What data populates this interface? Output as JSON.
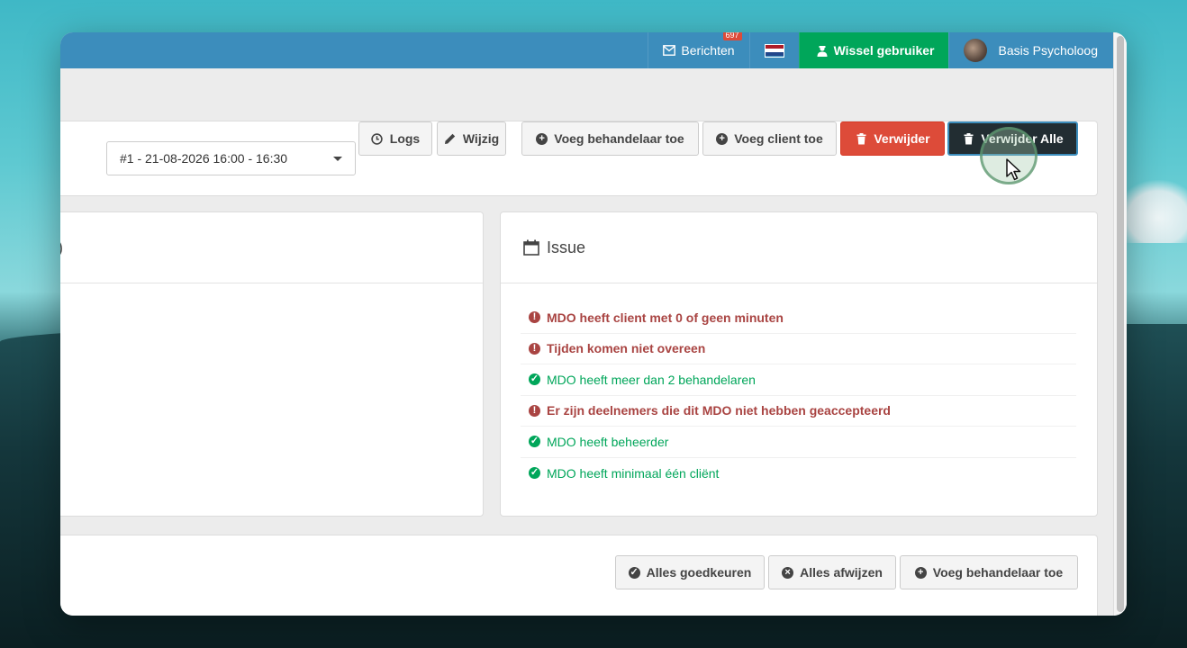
{
  "topbar": {
    "messages_label": "Berichten",
    "messages_count": "697",
    "switch_user_label": "Wissel gebruiker",
    "user_name": "Basis Psycholoog"
  },
  "toolbar": {
    "session_select_value": "#1 - 21-08-2026 16:00 - 16:30",
    "logs_label": "Logs",
    "edit_label": "Wijzig",
    "add_practitioner_label": "Voeg behandelaar toe",
    "add_client_label": "Voeg client toe",
    "delete_label": "Verwijder",
    "delete_all_label": "Verwijder Alle"
  },
  "left_panel": {
    "title_fragment": ")"
  },
  "issues": {
    "title": "Issue",
    "items": [
      {
        "text": "MDO heeft client met 0 of geen minuten",
        "status": "error"
      },
      {
        "text": "Tijden komen niet overeen",
        "status": "error"
      },
      {
        "text": "MDO heeft meer dan 2 behandelaren",
        "status": "ok"
      },
      {
        "text": "Er zijn deelnemers die dit MDO niet hebben geaccepteerd",
        "status": "error"
      },
      {
        "text": "MDO heeft beheerder",
        "status": "ok"
      },
      {
        "text": "MDO heeft minimaal één cliënt",
        "status": "ok"
      }
    ]
  },
  "bottom_toolbar": {
    "approve_all_label": "Alles goedkeuren",
    "reject_all_label": "Alles afwijzen",
    "add_practitioner_label": "Voeg behandelaar toe"
  },
  "colors": {
    "header": "#3c8dbc",
    "switch_user": "#00a65a",
    "danger": "#dd4b39",
    "dark": "#222d32",
    "error_text": "#a94442",
    "ok_text": "#00a65a"
  }
}
